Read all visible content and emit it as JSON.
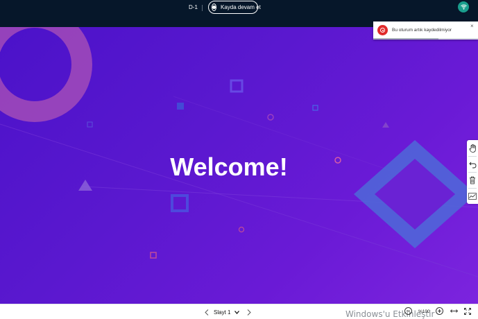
{
  "topbar": {
    "room_name": "D-1",
    "record_button_label": "Kayda devam et",
    "wifi_icon": "wifi-icon"
  },
  "toast": {
    "message": "Bu oturum artık kaydedilmiyor",
    "close_label": "×",
    "progress_fraction": 0.62,
    "icon": "record-icon"
  },
  "slide": {
    "title": "Welcome!"
  },
  "tools": [
    {
      "name": "hand-tool",
      "icon": "hand-icon"
    },
    {
      "name": "undo-tool",
      "icon": "undo-icon"
    },
    {
      "name": "delete-tool",
      "icon": "trash-icon"
    },
    {
      "name": "multi-user-tool",
      "icon": "line-chart-icon"
    }
  ],
  "bottombar": {
    "slide_label": "Slayt 1",
    "zoom_level": "%100"
  },
  "watermark": "Windows'u Etkinleştir",
  "colors": {
    "topbar_bg": "#06172a",
    "accent_green": "#1a9e8d",
    "toast_red": "#e02b2b",
    "slide_purple_start": "#4b12c9",
    "slide_purple_end": "#7c24de"
  }
}
